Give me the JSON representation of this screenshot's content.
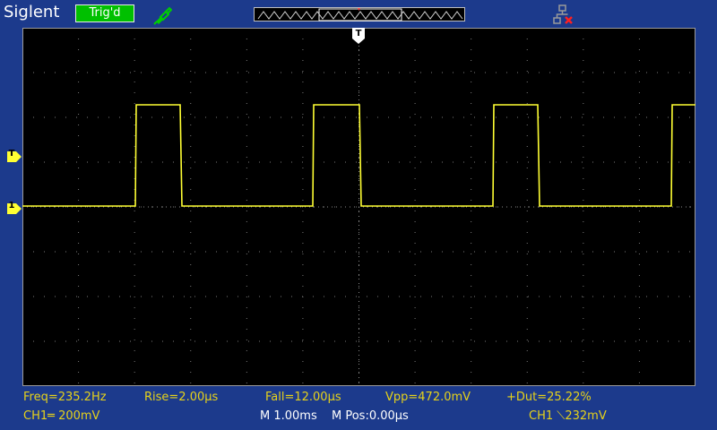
{
  "header": {
    "brand": "Siglent",
    "trigger_status": "Trig'd"
  },
  "icons": {
    "probe": "probe-icon",
    "network": "network-disconnected-icon",
    "trigger_position": "trigger-position-marker",
    "channel_level": "ch1-ground-marker",
    "trigger_level": "trigger-level-marker"
  },
  "markers": {
    "trigger_position_label": "T",
    "trigger_level_label": "T",
    "ch1_level_label": "1"
  },
  "measurements": {
    "freq": "Freq=235.2Hz",
    "rise": "Rise=2.00µs",
    "fall": "Fall=12.00µs",
    "vpp": "Vpp=472.0mV",
    "duty": "+Dut=25.22%"
  },
  "status": {
    "ch1_scale": "CH1═ 200mV",
    "timebase": "M 1.00ms",
    "position": "M Pos:0.00µs",
    "trigger": "CH1 ⟍232mV"
  },
  "colors": {
    "background": "#1c3a8c",
    "screen": "#000000",
    "trace": "#ffff33",
    "text_yellow": "#e6d21a",
    "trig_ok": "#00c000"
  }
}
